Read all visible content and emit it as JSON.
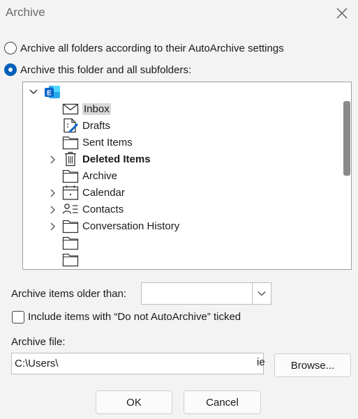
{
  "window": {
    "title": "Archive"
  },
  "options": {
    "autoarchive_label": "Archive all folders according to their AutoArchive settings",
    "this_folder_label": "Archive this folder and all subfolders:",
    "selected": "this_folder"
  },
  "tree": {
    "root_icon": "exchange-account-icon",
    "items": [
      {
        "label": "Inbox",
        "icon": "envelope-icon",
        "selected": true,
        "bold": false,
        "expandable": false
      },
      {
        "label": "Drafts",
        "icon": "drafts-icon",
        "selected": false,
        "bold": false,
        "expandable": false
      },
      {
        "label": "Sent Items",
        "icon": "folder-icon",
        "selected": false,
        "bold": false,
        "expandable": false
      },
      {
        "label": "Deleted Items",
        "icon": "trash-icon",
        "selected": false,
        "bold": true,
        "expandable": true
      },
      {
        "label": "Archive",
        "icon": "folder-icon",
        "selected": false,
        "bold": false,
        "expandable": false
      },
      {
        "label": "Calendar",
        "icon": "calendar-icon",
        "selected": false,
        "bold": false,
        "expandable": true
      },
      {
        "label": "Contacts",
        "icon": "contacts-icon",
        "selected": false,
        "bold": false,
        "expandable": true
      },
      {
        "label": "Conversation History",
        "icon": "folder-icon",
        "selected": false,
        "bold": false,
        "expandable": true
      },
      {
        "label": "",
        "icon": "folder-icon",
        "selected": false,
        "bold": false,
        "expandable": false
      },
      {
        "label": "",
        "icon": "folder-icon",
        "selected": false,
        "bold": false,
        "expandable": false
      }
    ]
  },
  "older_than": {
    "label": "Archive items older than:",
    "value": ""
  },
  "do_not_autoarchive": {
    "label": "Include items with “Do not AutoArchive” ticked",
    "checked": false
  },
  "archive_file": {
    "label": "Archive file:",
    "value": "C:\\Users\\",
    "overflow_text": "ie",
    "browse_label": "Browse..."
  },
  "buttons": {
    "ok": "OK",
    "cancel": "Cancel"
  },
  "colors": {
    "accent": "#005fb8",
    "selected_row": "#d9d9d9",
    "exchange_blue": "#0a64c8"
  }
}
